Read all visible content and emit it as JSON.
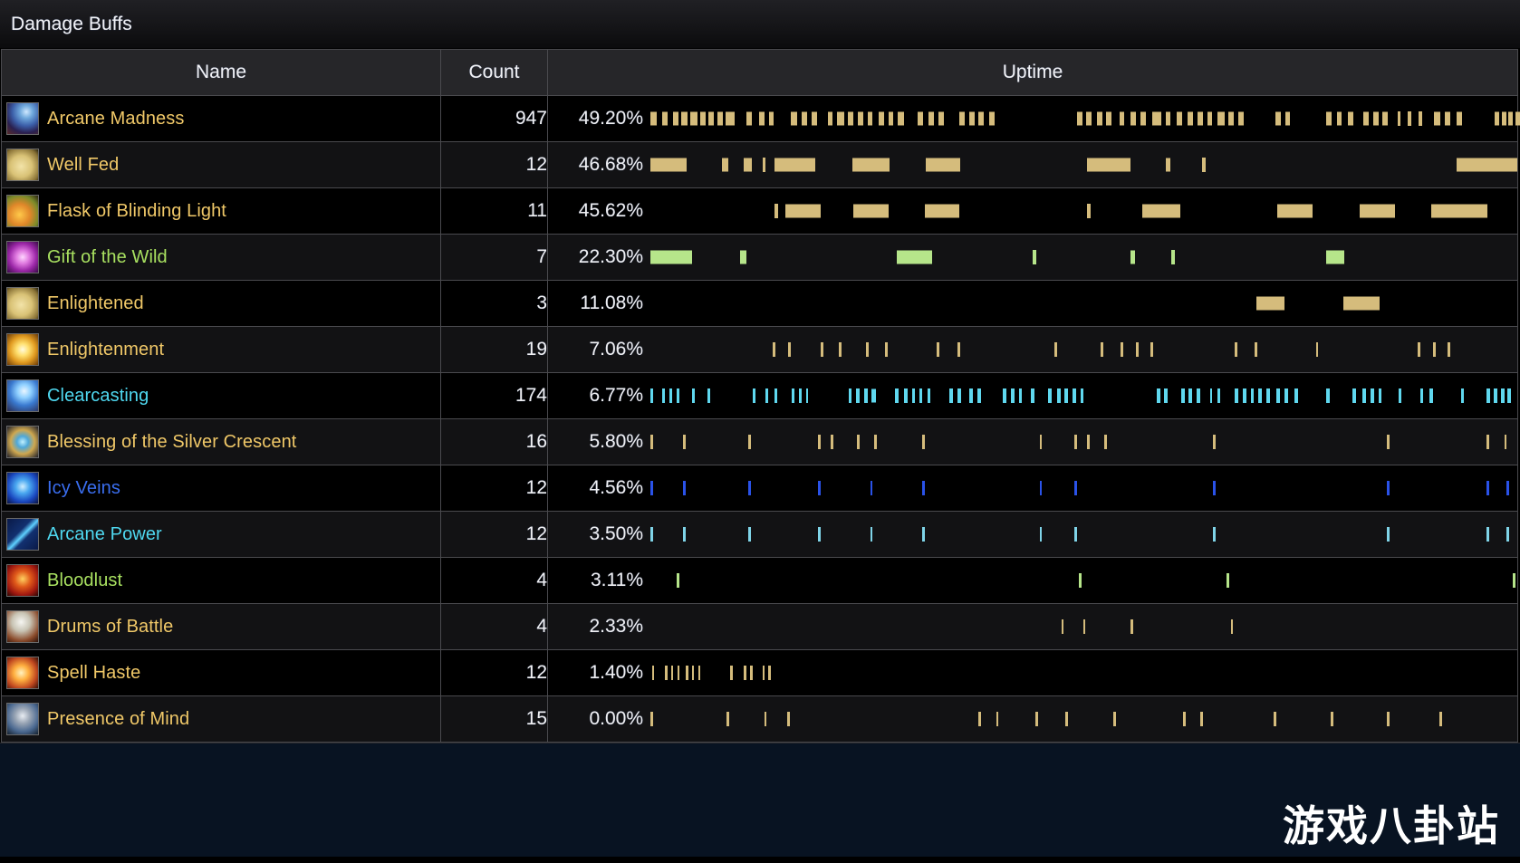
{
  "window": {
    "title": "Damage Buffs"
  },
  "table": {
    "columns": [
      "Name",
      "Count",
      "Uptime"
    ],
    "colors": {
      "row_odd_bg": "#000000",
      "row_even_bg": "#121214",
      "header_bg": "#262629",
      "grid": "#4a4a4e",
      "gold_text": "#f0c868",
      "green_text": "#a8e060",
      "cyan_text": "#4fd8f0",
      "blue_text": "#3a6ef0",
      "bar_gold": "#d5bc7c",
      "bar_green": "#b6e58a",
      "bar_cyan": "#5fd8ef",
      "bar_blue": "#2a52e8",
      "bar_lightblue": "#7fd4e8"
    },
    "rows": [
      {
        "icon": "arcane-madness-icon",
        "icon_style": "arcane-madness",
        "name": "Arcane Madness",
        "name_color": "#f0c868",
        "count": "947",
        "uptime": "49.20%",
        "bar_color": "#d5bc7c",
        "segments": [
          [
            0.2,
            0.7
          ],
          [
            1.6,
            0.6
          ],
          [
            2.8,
            0.6
          ],
          [
            3.8,
            0.7
          ],
          [
            4.8,
            0.8
          ],
          [
            5.9,
            0.7
          ],
          [
            6.9,
            0.6
          ],
          [
            7.9,
            0.7
          ],
          [
            8.9,
            1.0
          ],
          [
            11.3,
            0.6
          ],
          [
            12.7,
            0.6
          ],
          [
            13.9,
            0.5
          ],
          [
            16.4,
            0.7
          ],
          [
            17.6,
            0.6
          ],
          [
            18.8,
            0.6
          ],
          [
            20.6,
            0.6
          ],
          [
            21.7,
            0.8
          ],
          [
            22.9,
            0.7
          ],
          [
            24.1,
            0.6
          ],
          [
            25.2,
            0.6
          ],
          [
            26.5,
            0.6
          ],
          [
            27.6,
            0.6
          ],
          [
            28.7,
            0.7
          ],
          [
            31.0,
            0.6
          ],
          [
            32.2,
            0.6
          ],
          [
            33.4,
            0.6
          ],
          [
            35.8,
            0.6
          ],
          [
            36.9,
            0.6
          ],
          [
            38.0,
            0.6
          ],
          [
            39.2,
            0.6
          ],
          [
            49.3,
            0.6
          ],
          [
            50.4,
            0.6
          ],
          [
            51.6,
            0.6
          ],
          [
            52.7,
            0.6
          ],
          [
            54.2,
            0.5
          ],
          [
            55.5,
            0.6
          ],
          [
            56.6,
            0.6
          ],
          [
            58.0,
            1.0
          ],
          [
            59.5,
            0.6
          ],
          [
            60.8,
            0.6
          ],
          [
            62.0,
            0.7
          ],
          [
            63.2,
            0.6
          ],
          [
            64.3,
            0.6
          ],
          [
            65.5,
            0.8
          ],
          [
            66.7,
            0.7
          ],
          [
            67.9,
            0.6
          ],
          [
            72.2,
            0.6
          ],
          [
            73.3,
            0.5
          ],
          [
            78.0,
            0.6
          ],
          [
            79.2,
            0.6
          ],
          [
            80.5,
            0.6
          ],
          [
            82.3,
            0.6
          ],
          [
            83.4,
            0.6
          ],
          [
            84.5,
            0.6
          ],
          [
            86.2,
            0.4
          ],
          [
            87.4,
            0.4
          ],
          [
            88.6,
            0.4
          ],
          [
            90.4,
            0.7
          ],
          [
            91.7,
            0.6
          ],
          [
            93.0,
            0.6
          ],
          [
            97.4,
            0.5
          ],
          [
            98.2,
            0.5
          ],
          [
            99.0,
            0.5
          ],
          [
            99.8,
            0.5
          ],
          [
            100.6,
            0.5
          ],
          [
            101.4,
            0.5
          ]
        ]
      },
      {
        "icon": "well-fed-icon",
        "icon_style": "well-fed",
        "name": "Well Fed",
        "name_color": "#f0c868",
        "count": "12",
        "uptime": "46.68%",
        "bar_color": "#d5bc7c",
        "segments": [
          [
            0.2,
            4.2
          ],
          [
            8.4,
            0.8
          ],
          [
            11.0,
            0.9
          ],
          [
            13.1,
            0.4
          ],
          [
            14.5,
            4.7
          ],
          [
            23.5,
            4.2
          ],
          [
            31.9,
            4.0
          ],
          [
            50.5,
            5.0
          ],
          [
            59.5,
            0.6
          ],
          [
            63.7,
            0.4
          ],
          [
            93.0,
            7.0
          ]
        ]
      },
      {
        "icon": "flask-icon",
        "icon_style": "flask",
        "name": "Flask of Blinding Light",
        "name_color": "#f0c868",
        "count": "11",
        "uptime": "45.62%",
        "bar_color": "#d5bc7c",
        "segments": [
          [
            14.5,
            0.4
          ],
          [
            15.7,
            4.1
          ],
          [
            23.6,
            4.0
          ],
          [
            31.8,
            4.0
          ],
          [
            50.5,
            0.4
          ],
          [
            56.8,
            4.4
          ],
          [
            72.4,
            4.0
          ],
          [
            81.9,
            4.0
          ],
          [
            90.1,
            6.5
          ]
        ]
      },
      {
        "icon": "gift-of-the-wild-icon",
        "icon_style": "gift-wild",
        "name": "Gift of the Wild",
        "name_color": "#a8e060",
        "count": "7",
        "uptime": "22.30%",
        "bar_color": "#b6e58a",
        "segments": [
          [
            0.2,
            4.8
          ],
          [
            10.5,
            0.8
          ],
          [
            28.6,
            4.0
          ],
          [
            44.2,
            0.4
          ],
          [
            55.5,
            0.5
          ],
          [
            60.2,
            0.4
          ],
          [
            78.0,
            2.1
          ]
        ]
      },
      {
        "icon": "enlightened-icon",
        "icon_style": "well-fed",
        "name": "Enlightened",
        "name_color": "#f0c868",
        "count": "3",
        "uptime": "11.08%",
        "bar_color": "#d5bc7c",
        "segments": [
          [
            70.0,
            3.2
          ],
          [
            80.0,
            4.2
          ]
        ]
      },
      {
        "icon": "enlightenment-icon",
        "icon_style": "enlightenment",
        "name": "Enlightenment",
        "name_color": "#f0c868",
        "count": "19",
        "uptime": "7.06%",
        "bar_color": "#d5bc7c",
        "segments": [
          [
            14.3,
            0.3
          ],
          [
            16.1,
            0.3
          ],
          [
            19.8,
            0.3
          ],
          [
            21.9,
            0.3
          ],
          [
            25.0,
            0.3
          ],
          [
            27.2,
            0.3
          ],
          [
            33.2,
            0.3
          ],
          [
            35.6,
            0.3
          ],
          [
            46.7,
            0.3
          ],
          [
            52.0,
            0.3
          ],
          [
            54.3,
            0.3
          ],
          [
            56.1,
            0.3
          ],
          [
            57.8,
            0.3
          ],
          [
            67.5,
            0.3
          ],
          [
            69.8,
            0.3
          ],
          [
            76.8,
            0.3
          ],
          [
            88.5,
            0.3
          ],
          [
            90.3,
            0.3
          ],
          [
            92.0,
            0.3
          ]
        ]
      },
      {
        "icon": "clearcasting-icon",
        "icon_style": "clearcasting",
        "name": "Clearcasting",
        "name_color": "#4fd8f0",
        "count": "174",
        "uptime": "6.77%",
        "bar_color": "#5fd8ef",
        "segments": [
          [
            0.2,
            0.3
          ],
          [
            1.6,
            0.3
          ],
          [
            2.4,
            0.3
          ],
          [
            3.2,
            0.3
          ],
          [
            5.0,
            0.3
          ],
          [
            6.8,
            0.3
          ],
          [
            12.0,
            0.3
          ],
          [
            13.5,
            0.3
          ],
          [
            14.5,
            0.3
          ],
          [
            16.5,
            0.3
          ],
          [
            17.3,
            0.3
          ],
          [
            18.1,
            0.3
          ],
          [
            23.0,
            0.4
          ],
          [
            23.9,
            0.4
          ],
          [
            24.8,
            0.4
          ],
          [
            25.7,
            0.5
          ],
          [
            28.4,
            0.4
          ],
          [
            29.4,
            0.4
          ],
          [
            30.3,
            0.4
          ],
          [
            31.2,
            0.3
          ],
          [
            32.1,
            0.3
          ],
          [
            34.6,
            0.4
          ],
          [
            35.6,
            0.4
          ],
          [
            36.9,
            0.4
          ],
          [
            37.9,
            0.4
          ],
          [
            40.8,
            0.4
          ],
          [
            41.7,
            0.4
          ],
          [
            42.6,
            0.4
          ],
          [
            44.0,
            0.4
          ],
          [
            46.0,
            0.4
          ],
          [
            47.0,
            0.4
          ],
          [
            47.9,
            0.4
          ],
          [
            48.8,
            0.4
          ],
          [
            49.7,
            0.4
          ],
          [
            58.5,
            0.4
          ],
          [
            59.3,
            0.4
          ],
          [
            61.3,
            0.4
          ],
          [
            62.2,
            0.4
          ],
          [
            63.1,
            0.4
          ],
          [
            64.6,
            0.3
          ],
          [
            65.5,
            0.3
          ],
          [
            67.5,
            0.4
          ],
          [
            68.4,
            0.4
          ],
          [
            69.3,
            0.4
          ],
          [
            70.2,
            0.4
          ],
          [
            71.1,
            0.4
          ],
          [
            72.3,
            0.4
          ],
          [
            73.2,
            0.4
          ],
          [
            74.4,
            0.4
          ],
          [
            78.0,
            0.4
          ],
          [
            81.0,
            0.4
          ],
          [
            82.2,
            0.4
          ],
          [
            83.1,
            0.4
          ],
          [
            84.0,
            0.4
          ],
          [
            86.3,
            0.4
          ],
          [
            88.8,
            0.4
          ],
          [
            89.9,
            0.4
          ],
          [
            93.5,
            0.4
          ],
          [
            96.5,
            0.4
          ],
          [
            97.3,
            0.4
          ],
          [
            98.1,
            0.4
          ],
          [
            98.9,
            0.4
          ]
        ]
      },
      {
        "icon": "blessing-silver-crescent-icon",
        "icon_style": "silver-crescent",
        "name": "Blessing of the Silver Crescent",
        "name_color": "#f0c868",
        "count": "16",
        "uptime": "5.80%",
        "bar_color": "#d5bc7c",
        "segments": [
          [
            0.2,
            0.3
          ],
          [
            4.0,
            0.3
          ],
          [
            11.5,
            0.3
          ],
          [
            19.5,
            0.3
          ],
          [
            21.0,
            0.3
          ],
          [
            24.0,
            0.3
          ],
          [
            26.0,
            0.3
          ],
          [
            31.5,
            0.3
          ],
          [
            45.0,
            0.3
          ],
          [
            49.0,
            0.3
          ],
          [
            50.5,
            0.3
          ],
          [
            52.5,
            0.3
          ],
          [
            65.0,
            0.3
          ],
          [
            85.0,
            0.3
          ],
          [
            96.5,
            0.3
          ],
          [
            98.5,
            0.3
          ]
        ]
      },
      {
        "icon": "icy-veins-icon",
        "icon_style": "icy-veins",
        "name": "Icy Veins",
        "name_color": "#3a6ef0",
        "count": "12",
        "uptime": "4.56%",
        "bar_color": "#2a52e8",
        "segments": [
          [
            0.2,
            0.3
          ],
          [
            4.0,
            0.3
          ],
          [
            11.5,
            0.3
          ],
          [
            19.5,
            0.3
          ],
          [
            25.5,
            0.3
          ],
          [
            31.5,
            0.3
          ],
          [
            45.0,
            0.3
          ],
          [
            49.0,
            0.3
          ],
          [
            65.0,
            0.3
          ],
          [
            85.0,
            0.3
          ],
          [
            96.5,
            0.3
          ],
          [
            98.8,
            0.3
          ]
        ]
      },
      {
        "icon": "arcane-power-icon",
        "icon_style": "arcane-power",
        "name": "Arcane Power",
        "name_color": "#4fd8f0",
        "count": "12",
        "uptime": "3.50%",
        "bar_color": "#7fd4e8",
        "segments": [
          [
            0.2,
            0.3
          ],
          [
            4.0,
            0.3
          ],
          [
            11.5,
            0.3
          ],
          [
            19.5,
            0.3
          ],
          [
            25.5,
            0.3
          ],
          [
            31.5,
            0.3
          ],
          [
            45.0,
            0.3
          ],
          [
            49.0,
            0.3
          ],
          [
            65.0,
            0.3
          ],
          [
            85.0,
            0.3
          ],
          [
            96.5,
            0.3
          ],
          [
            98.8,
            0.3
          ]
        ]
      },
      {
        "icon": "bloodlust-icon",
        "icon_style": "bloodlust",
        "name": "Bloodlust",
        "name_color": "#a8e060",
        "count": "4",
        "uptime": "3.11%",
        "bar_color": "#b6e58a",
        "segments": [
          [
            3.2,
            0.3
          ],
          [
            49.5,
            0.3
          ],
          [
            66.5,
            0.3
          ],
          [
            99.5,
            0.3
          ]
        ]
      },
      {
        "icon": "drums-of-battle-icon",
        "icon_style": "drums",
        "name": "Drums of Battle",
        "name_color": "#f0c868",
        "count": "4",
        "uptime": "2.33%",
        "bar_color": "#d5bc7c",
        "segments": [
          [
            47.5,
            0.3
          ],
          [
            50.0,
            0.3
          ],
          [
            55.5,
            0.3
          ],
          [
            67.0,
            0.3
          ]
        ]
      },
      {
        "icon": "spell-haste-icon",
        "icon_style": "spell-haste",
        "name": "Spell Haste",
        "name_color": "#f0c868",
        "count": "12",
        "uptime": "1.40%",
        "bar_color": "#d5bc7c",
        "segments": [
          [
            0.4,
            0.25
          ],
          [
            1.9,
            0.25
          ],
          [
            2.6,
            0.25
          ],
          [
            3.3,
            0.25
          ],
          [
            4.3,
            0.25
          ],
          [
            5.0,
            0.25
          ],
          [
            5.7,
            0.25
          ],
          [
            9.4,
            0.25
          ],
          [
            11.0,
            0.25
          ],
          [
            11.7,
            0.25
          ],
          [
            13.1,
            0.25
          ],
          [
            13.8,
            0.25
          ]
        ]
      },
      {
        "icon": "presence-of-mind-icon",
        "icon_style": "presence-of-mind",
        "name": "Presence of Mind",
        "name_color": "#f0c868",
        "count": "15",
        "uptime": "0.00%",
        "bar_color": "#d5bc7c",
        "segments": [
          [
            0.2,
            0.3
          ],
          [
            9.0,
            0.3
          ],
          [
            13.3,
            0.3
          ],
          [
            16.0,
            0.3
          ],
          [
            38.0,
            0.3
          ],
          [
            40.0,
            0.3
          ],
          [
            44.5,
            0.3
          ],
          [
            48.0,
            0.3
          ],
          [
            53.5,
            0.3
          ],
          [
            61.5,
            0.3
          ],
          [
            63.5,
            0.3
          ],
          [
            72.0,
            0.3
          ],
          [
            78.5,
            0.3
          ],
          [
            85.0,
            0.3
          ],
          [
            91.0,
            0.3
          ]
        ]
      }
    ]
  },
  "footer": {
    "watermark": "游戏八卦站"
  }
}
